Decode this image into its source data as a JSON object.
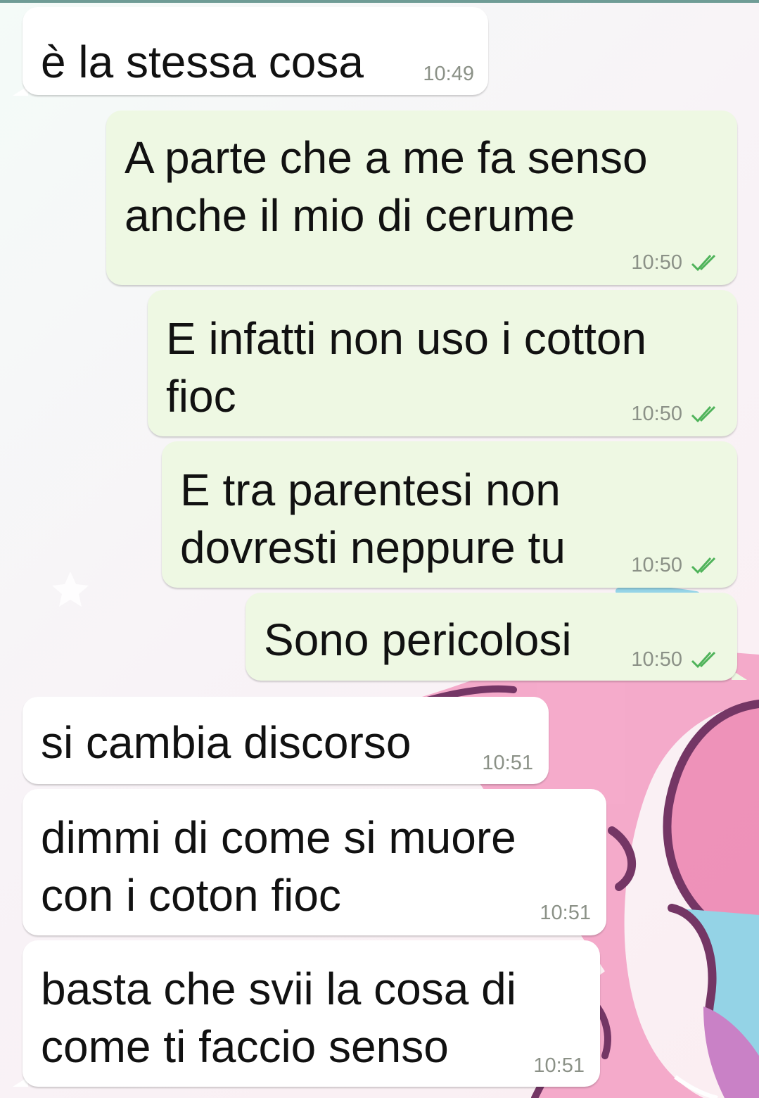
{
  "messages": [
    {
      "direction": "in",
      "lines": [
        "è la stessa cosa"
      ],
      "time": "10:49",
      "status": ""
    },
    {
      "direction": "out",
      "lines": [
        "A parte che a me fa senso",
        "anche il mio di cerume"
      ],
      "time": "10:50",
      "status": "read-double-check-icon"
    },
    {
      "direction": "out",
      "lines": [
        "E infatti non uso i cotton",
        "fioc"
      ],
      "time": "10:50",
      "status": "read-double-check-icon"
    },
    {
      "direction": "out",
      "lines": [
        "E tra parentesi non",
        "dovresti neppure tu"
      ],
      "time": "10:50",
      "status": "read-double-check-icon"
    },
    {
      "direction": "out",
      "lines": [
        "Sono pericolosi"
      ],
      "time": "10:50",
      "status": "read-double-check-icon"
    },
    {
      "direction": "in",
      "lines": [
        "si cambia discorso"
      ],
      "time": "10:51",
      "status": ""
    },
    {
      "direction": "in",
      "lines": [
        "dimmi di come si muore",
        "con i coton fioc"
      ],
      "time": "10:51",
      "status": ""
    },
    {
      "direction": "in",
      "lines": [
        "basta che svii la cosa di",
        "come ti faccio senso"
      ],
      "time": "10:51",
      "status": ""
    }
  ],
  "colors": {
    "incoming_bubble": "#ffffff",
    "outgoing_bubble": "#eef8e3",
    "timestamp": "#8b9187",
    "read_ticks": "#4fb35a"
  }
}
